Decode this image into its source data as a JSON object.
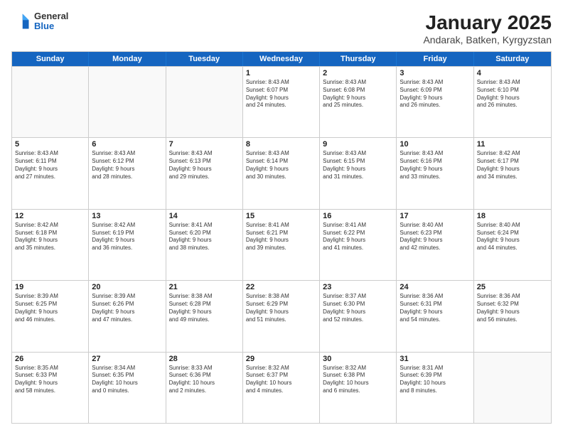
{
  "logo": {
    "general": "General",
    "blue": "Blue"
  },
  "title": "January 2025",
  "subtitle": "Andarak, Batken, Kyrgyzstan",
  "days": [
    "Sunday",
    "Monday",
    "Tuesday",
    "Wednesday",
    "Thursday",
    "Friday",
    "Saturday"
  ],
  "weeks": [
    [
      {
        "day": "",
        "info": ""
      },
      {
        "day": "",
        "info": ""
      },
      {
        "day": "",
        "info": ""
      },
      {
        "day": "1",
        "info": "Sunrise: 8:43 AM\nSunset: 6:07 PM\nDaylight: 9 hours\nand 24 minutes."
      },
      {
        "day": "2",
        "info": "Sunrise: 8:43 AM\nSunset: 6:08 PM\nDaylight: 9 hours\nand 25 minutes."
      },
      {
        "day": "3",
        "info": "Sunrise: 8:43 AM\nSunset: 6:09 PM\nDaylight: 9 hours\nand 26 minutes."
      },
      {
        "day": "4",
        "info": "Sunrise: 8:43 AM\nSunset: 6:10 PM\nDaylight: 9 hours\nand 26 minutes."
      }
    ],
    [
      {
        "day": "5",
        "info": "Sunrise: 8:43 AM\nSunset: 6:11 PM\nDaylight: 9 hours\nand 27 minutes."
      },
      {
        "day": "6",
        "info": "Sunrise: 8:43 AM\nSunset: 6:12 PM\nDaylight: 9 hours\nand 28 minutes."
      },
      {
        "day": "7",
        "info": "Sunrise: 8:43 AM\nSunset: 6:13 PM\nDaylight: 9 hours\nand 29 minutes."
      },
      {
        "day": "8",
        "info": "Sunrise: 8:43 AM\nSunset: 6:14 PM\nDaylight: 9 hours\nand 30 minutes."
      },
      {
        "day": "9",
        "info": "Sunrise: 8:43 AM\nSunset: 6:15 PM\nDaylight: 9 hours\nand 31 minutes."
      },
      {
        "day": "10",
        "info": "Sunrise: 8:43 AM\nSunset: 6:16 PM\nDaylight: 9 hours\nand 33 minutes."
      },
      {
        "day": "11",
        "info": "Sunrise: 8:42 AM\nSunset: 6:17 PM\nDaylight: 9 hours\nand 34 minutes."
      }
    ],
    [
      {
        "day": "12",
        "info": "Sunrise: 8:42 AM\nSunset: 6:18 PM\nDaylight: 9 hours\nand 35 minutes."
      },
      {
        "day": "13",
        "info": "Sunrise: 8:42 AM\nSunset: 6:19 PM\nDaylight: 9 hours\nand 36 minutes."
      },
      {
        "day": "14",
        "info": "Sunrise: 8:41 AM\nSunset: 6:20 PM\nDaylight: 9 hours\nand 38 minutes."
      },
      {
        "day": "15",
        "info": "Sunrise: 8:41 AM\nSunset: 6:21 PM\nDaylight: 9 hours\nand 39 minutes."
      },
      {
        "day": "16",
        "info": "Sunrise: 8:41 AM\nSunset: 6:22 PM\nDaylight: 9 hours\nand 41 minutes."
      },
      {
        "day": "17",
        "info": "Sunrise: 8:40 AM\nSunset: 6:23 PM\nDaylight: 9 hours\nand 42 minutes."
      },
      {
        "day": "18",
        "info": "Sunrise: 8:40 AM\nSunset: 6:24 PM\nDaylight: 9 hours\nand 44 minutes."
      }
    ],
    [
      {
        "day": "19",
        "info": "Sunrise: 8:39 AM\nSunset: 6:25 PM\nDaylight: 9 hours\nand 46 minutes."
      },
      {
        "day": "20",
        "info": "Sunrise: 8:39 AM\nSunset: 6:26 PM\nDaylight: 9 hours\nand 47 minutes."
      },
      {
        "day": "21",
        "info": "Sunrise: 8:38 AM\nSunset: 6:28 PM\nDaylight: 9 hours\nand 49 minutes."
      },
      {
        "day": "22",
        "info": "Sunrise: 8:38 AM\nSunset: 6:29 PM\nDaylight: 9 hours\nand 51 minutes."
      },
      {
        "day": "23",
        "info": "Sunrise: 8:37 AM\nSunset: 6:30 PM\nDaylight: 9 hours\nand 52 minutes."
      },
      {
        "day": "24",
        "info": "Sunrise: 8:36 AM\nSunset: 6:31 PM\nDaylight: 9 hours\nand 54 minutes."
      },
      {
        "day": "25",
        "info": "Sunrise: 8:36 AM\nSunset: 6:32 PM\nDaylight: 9 hours\nand 56 minutes."
      }
    ],
    [
      {
        "day": "26",
        "info": "Sunrise: 8:35 AM\nSunset: 6:33 PM\nDaylight: 9 hours\nand 58 minutes."
      },
      {
        "day": "27",
        "info": "Sunrise: 8:34 AM\nSunset: 6:35 PM\nDaylight: 10 hours\nand 0 minutes."
      },
      {
        "day": "28",
        "info": "Sunrise: 8:33 AM\nSunset: 6:36 PM\nDaylight: 10 hours\nand 2 minutes."
      },
      {
        "day": "29",
        "info": "Sunrise: 8:32 AM\nSunset: 6:37 PM\nDaylight: 10 hours\nand 4 minutes."
      },
      {
        "day": "30",
        "info": "Sunrise: 8:32 AM\nSunset: 6:38 PM\nDaylight: 10 hours\nand 6 minutes."
      },
      {
        "day": "31",
        "info": "Sunrise: 8:31 AM\nSunset: 6:39 PM\nDaylight: 10 hours\nand 8 minutes."
      },
      {
        "day": "",
        "info": ""
      }
    ]
  ]
}
